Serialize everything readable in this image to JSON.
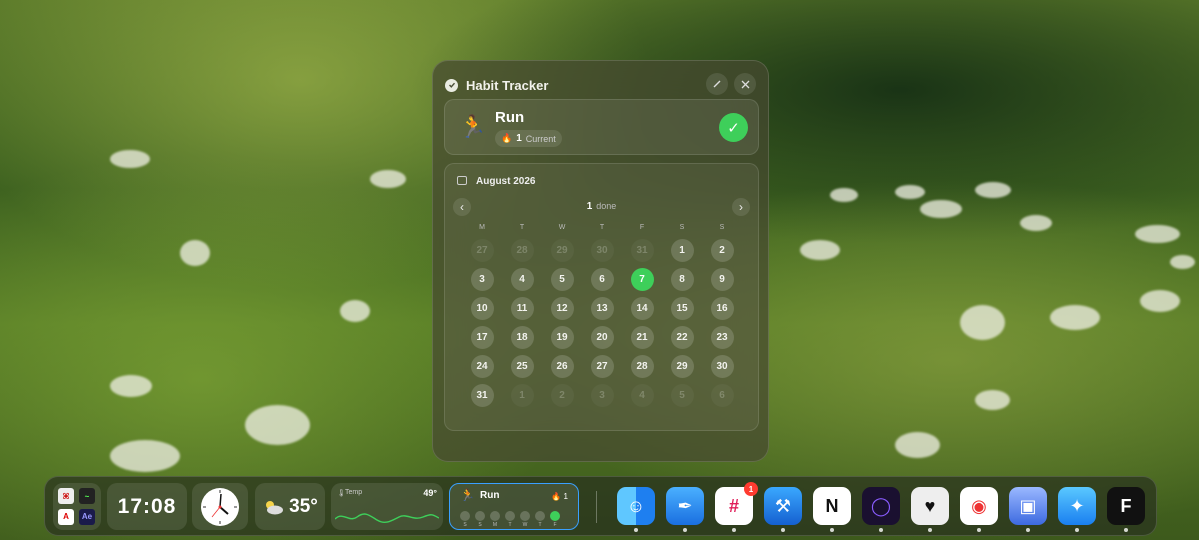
{
  "panel": {
    "title": "Habit Tracker",
    "habit": {
      "name": "Run",
      "emoji": "🏃",
      "streak_count": "1",
      "streak_label": "Current",
      "streak_icon": "🔥"
    },
    "calendar": {
      "month": "August 2026",
      "done_count": "1",
      "done_label": "done",
      "weekdays": [
        "M",
        "T",
        "W",
        "T",
        "F",
        "S",
        "S"
      ],
      "days": [
        {
          "d": "27",
          "s": "out"
        },
        {
          "d": "28",
          "s": "out"
        },
        {
          "d": "29",
          "s": "out"
        },
        {
          "d": "30",
          "s": "out"
        },
        {
          "d": "31",
          "s": "out"
        },
        {
          "d": "1",
          "s": "in"
        },
        {
          "d": "2",
          "s": "in"
        },
        {
          "d": "3",
          "s": "in"
        },
        {
          "d": "4",
          "s": "in"
        },
        {
          "d": "5",
          "s": "in"
        },
        {
          "d": "6",
          "s": "in"
        },
        {
          "d": "7",
          "s": "done"
        },
        {
          "d": "8",
          "s": "in"
        },
        {
          "d": "9",
          "s": "in"
        },
        {
          "d": "10",
          "s": "in"
        },
        {
          "d": "11",
          "s": "in"
        },
        {
          "d": "12",
          "s": "in"
        },
        {
          "d": "13",
          "s": "in"
        },
        {
          "d": "14",
          "s": "in"
        },
        {
          "d": "15",
          "s": "in"
        },
        {
          "d": "16",
          "s": "in"
        },
        {
          "d": "17",
          "s": "in"
        },
        {
          "d": "18",
          "s": "in"
        },
        {
          "d": "19",
          "s": "in"
        },
        {
          "d": "20",
          "s": "in"
        },
        {
          "d": "21",
          "s": "in"
        },
        {
          "d": "22",
          "s": "in"
        },
        {
          "d": "23",
          "s": "in"
        },
        {
          "d": "24",
          "s": "in"
        },
        {
          "d": "25",
          "s": "in"
        },
        {
          "d": "26",
          "s": "in"
        },
        {
          "d": "27",
          "s": "in"
        },
        {
          "d": "28",
          "s": "in"
        },
        {
          "d": "29",
          "s": "in"
        },
        {
          "d": "30",
          "s": "in"
        },
        {
          "d": "31",
          "s": "in"
        },
        {
          "d": "1",
          "s": "out"
        },
        {
          "d": "2",
          "s": "out"
        },
        {
          "d": "3",
          "s": "out"
        },
        {
          "d": "4",
          "s": "out"
        },
        {
          "d": "5",
          "s": "out"
        },
        {
          "d": "6",
          "s": "out"
        }
      ]
    },
    "accent": "#3ecf5a"
  },
  "dock": {
    "time": "17:08",
    "weather_temp": "35°",
    "temp_widget": {
      "label": "Temp",
      "value": "49°"
    },
    "run_widget": {
      "name": "Run",
      "count": "1",
      "letters": [
        "S",
        "S",
        "M",
        "T",
        "W",
        "T",
        "F"
      ]
    },
    "apps": [
      {
        "name": "finder",
        "label": "Finder"
      },
      {
        "name": "quill",
        "label": "Quill"
      },
      {
        "name": "slack",
        "label": "Slack",
        "badge": "1"
      },
      {
        "name": "xcode",
        "label": "Xcode"
      },
      {
        "name": "notion",
        "label": "Notion"
      },
      {
        "name": "orb",
        "label": "Orb"
      },
      {
        "name": "heart",
        "label": "Heart"
      },
      {
        "name": "chrome",
        "label": "Chrome"
      },
      {
        "name": "jar",
        "label": "Jar"
      },
      {
        "name": "safari",
        "label": "Safari"
      },
      {
        "name": "framer",
        "label": "Framer"
      }
    ]
  }
}
